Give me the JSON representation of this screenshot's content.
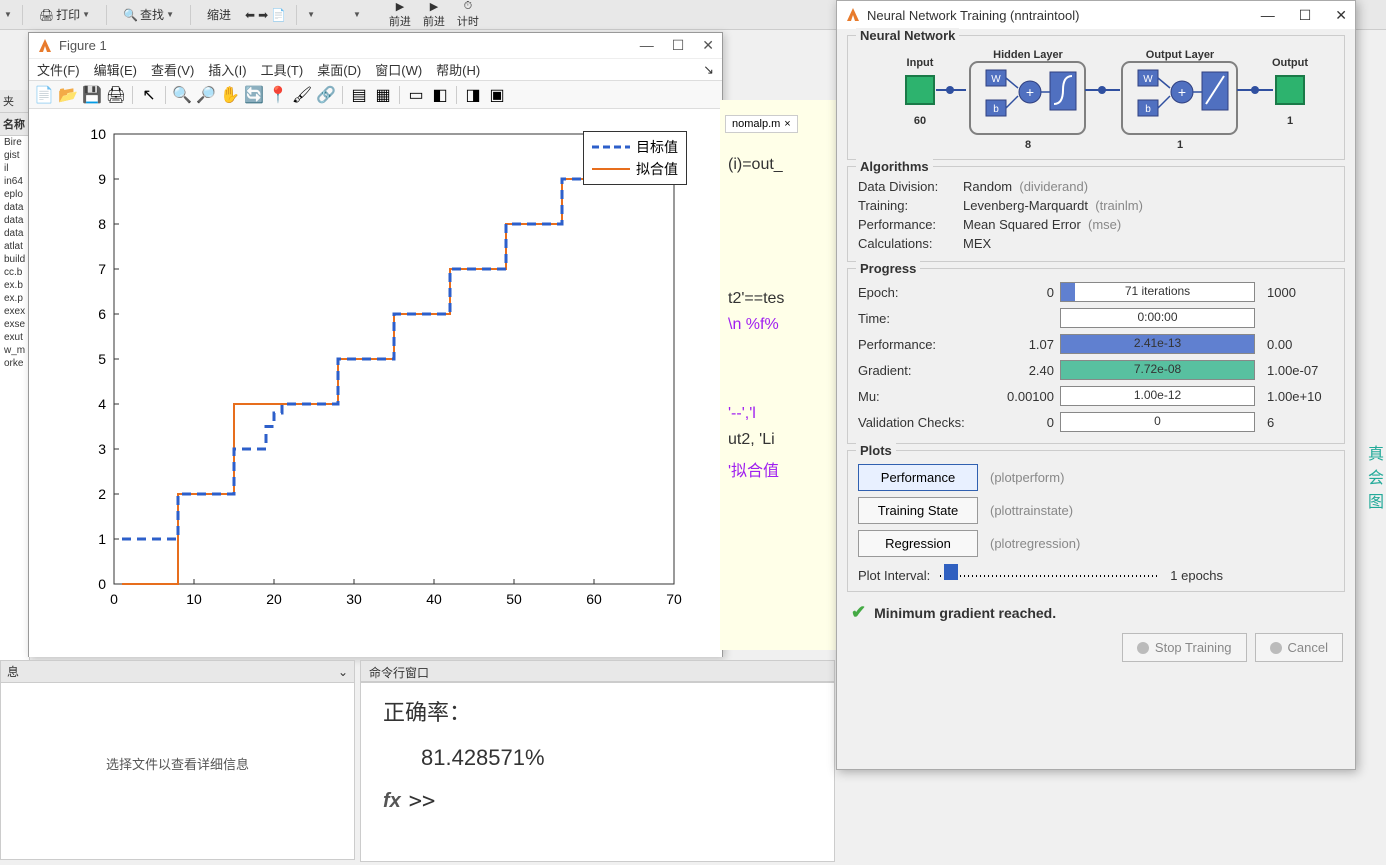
{
  "top_toolbar": {
    "print": "打印",
    "find": "查找",
    "indent": "缩进",
    "forward": "前进",
    "back": "前进",
    "timer": "计时"
  },
  "file_browser": {
    "header": "夹",
    "name_col": "名称",
    "items": [
      "Bire",
      "gist",
      "il",
      "in64",
      "eplo",
      "data",
      "data",
      "data",
      "atlat",
      "build",
      "cc.b",
      "ex.b",
      "ex.p",
      "exex",
      "exse",
      "exut",
      "w_m",
      "orke"
    ]
  },
  "figure": {
    "title": "Figure 1",
    "menu_file": "文件(F)",
    "menu_edit": "编辑(E)",
    "menu_view": "查看(V)",
    "menu_insert": "插入(I)",
    "menu_tools": "工具(T)",
    "menu_desktop": "桌面(D)",
    "menu_window": "窗口(W)",
    "menu_help": "帮助(H)",
    "legend_target": "目标值",
    "legend_fit": "拟合值"
  },
  "chart_data": {
    "type": "line",
    "xlim": [
      0,
      70
    ],
    "ylim": [
      0,
      10
    ],
    "xticks": [
      0,
      10,
      20,
      30,
      40,
      50,
      60,
      70
    ],
    "yticks": [
      0,
      1,
      2,
      3,
      4,
      5,
      6,
      7,
      8,
      9,
      10
    ],
    "series": [
      {
        "name": "目标值",
        "style": "dashed",
        "color": "#2d5fca",
        "x": [
          1,
          2,
          3,
          4,
          5,
          6,
          7,
          8,
          9,
          10,
          11,
          12,
          13,
          14,
          15,
          16,
          17,
          18,
          19,
          20,
          21,
          22,
          23,
          24,
          25,
          26,
          27,
          28,
          29,
          30,
          31,
          32,
          33,
          34,
          35,
          36,
          37,
          38,
          39,
          40,
          41,
          42,
          43,
          44,
          45,
          46,
          47,
          48,
          49,
          50,
          51,
          52,
          53,
          54,
          55,
          56,
          57,
          58,
          59,
          60,
          61,
          62,
          63,
          64,
          65,
          66,
          67,
          68,
          69,
          70
        ],
        "y": [
          1,
          1,
          1,
          1,
          1,
          1,
          1,
          2,
          2,
          2,
          2,
          2,
          2,
          2,
          3,
          3,
          3,
          3,
          3.5,
          3.8,
          4,
          4,
          4,
          4,
          4,
          4,
          4,
          5,
          5,
          5,
          5,
          5,
          5,
          5,
          6,
          6,
          6,
          6,
          6,
          6,
          6,
          7,
          7,
          7,
          7,
          7,
          7,
          7,
          8,
          8,
          8,
          8,
          8,
          8,
          8,
          9,
          9,
          9,
          9,
          9,
          9,
          9,
          10,
          10,
          10,
          10,
          10,
          10,
          10,
          10
        ]
      },
      {
        "name": "拟合值",
        "style": "solid",
        "color": "#e76e1d",
        "x": [
          1,
          2,
          3,
          4,
          5,
          6,
          7,
          8,
          9,
          10,
          11,
          12,
          13,
          14,
          15,
          16,
          17,
          18,
          19,
          20,
          21,
          22,
          23,
          24,
          25,
          26,
          27,
          28,
          29,
          30,
          31,
          32,
          33,
          34,
          35,
          36,
          37,
          38,
          39,
          40,
          41,
          42,
          43,
          44,
          45,
          46,
          47,
          48,
          49,
          50,
          51,
          52,
          53,
          54,
          55,
          56,
          57,
          58,
          59,
          60,
          61,
          62,
          63,
          64,
          65,
          66,
          67,
          68,
          69,
          70
        ],
        "y": [
          0,
          0,
          0,
          0,
          0,
          0,
          0,
          2,
          2,
          2,
          2,
          2,
          2,
          2,
          4,
          4,
          4,
          4,
          4,
          4,
          4,
          4,
          4,
          4,
          4,
          4,
          4,
          5,
          5,
          5,
          5,
          5,
          5,
          5,
          6,
          6,
          6,
          6,
          6,
          6,
          6,
          7,
          7,
          7,
          7,
          7,
          7,
          7,
          8,
          8,
          8,
          8,
          8,
          8,
          8,
          9,
          9,
          9,
          9,
          9,
          9,
          9,
          10,
          10,
          10,
          10,
          10,
          10,
          10,
          10
        ]
      }
    ]
  },
  "editor": {
    "tab_name": "nomalp.m",
    "line1": "(i)=out_",
    "line2": "t2'==tes",
    "line3_a": "\\n     %f%",
    "line4_a": "'--','l",
    "line4_b": "ut2, 'Li",
    "line4_c": "'拟合值"
  },
  "cmd": {
    "header": "命令行窗口",
    "line1": "正确率：",
    "line2": "81.428571%",
    "prompt": ">>"
  },
  "bottom_info": {
    "header": "息",
    "body": "选择文件以查看详细信息"
  },
  "nn": {
    "title": "Neural Network Training (nntraintool)",
    "section_network": "Neural Network",
    "diagram": {
      "input_label": "Input",
      "input_n": "60",
      "hidden_label": "Hidden Layer",
      "hidden_n": "8",
      "output_label": "Output Layer",
      "output_n": "1",
      "final_label": "Output",
      "final_n": "1"
    },
    "section_algo": "Algorithms",
    "algo": {
      "datadiv_label": "Data Division:",
      "datadiv_val": "Random",
      "datadiv_func": "(dividerand)",
      "training_label": "Training:",
      "training_val": "Levenberg-Marquardt",
      "training_func": "(trainlm)",
      "perf_label": "Performance:",
      "perf_val": "Mean Squared Error",
      "perf_func": "(mse)",
      "calc_label": "Calculations:",
      "calc_val": "MEX"
    },
    "section_progress": "Progress",
    "progress": {
      "epoch_label": "Epoch:",
      "epoch_start": "0",
      "epoch_text": "71 iterations",
      "epoch_end": "1000",
      "time_label": "Time:",
      "time_text": "0:00:00",
      "perf_label": "Performance:",
      "perf_start": "1.07",
      "perf_text": "2.41e-13",
      "perf_end": "0.00",
      "grad_label": "Gradient:",
      "grad_start": "2.40",
      "grad_text": "7.72e-08",
      "grad_end": "1.00e-07",
      "mu_label": "Mu:",
      "mu_start": "0.00100",
      "mu_text": "1.00e-12",
      "mu_end": "1.00e+10",
      "val_label": "Validation Checks:",
      "val_start": "0",
      "val_text": "0",
      "val_end": "6"
    },
    "section_plots": "Plots",
    "plots": {
      "perf_btn": "Performance",
      "perf_func": "(plotperform)",
      "train_btn": "Training State",
      "train_func": "(plottrainstate)",
      "reg_btn": "Regression",
      "reg_func": "(plotregression)",
      "interval_label": "Plot Interval:",
      "interval_val": "1 epochs"
    },
    "status": "Minimum gradient reached.",
    "btn_stop": "Stop Training",
    "btn_cancel": "Cancel"
  },
  "right_edge": {
    "l1": "真",
    "l2": "会",
    "l3": "图"
  }
}
